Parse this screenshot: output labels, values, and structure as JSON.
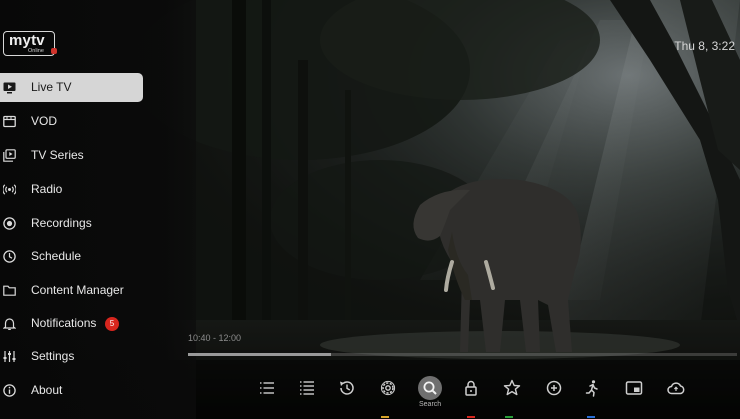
{
  "app": {
    "logo_text": "mytv",
    "logo_sub": "Online"
  },
  "clock": "Thu 8, 3:22",
  "sidebar": {
    "items": [
      {
        "label": "Live TV",
        "icon": "live-tv-icon",
        "active": true
      },
      {
        "label": "VOD",
        "icon": "vod-icon"
      },
      {
        "label": "TV Series",
        "icon": "tv-series-icon"
      },
      {
        "label": "Radio",
        "icon": "radio-icon"
      },
      {
        "label": "Recordings",
        "icon": "recordings-icon"
      },
      {
        "label": "Schedule",
        "icon": "schedule-icon"
      },
      {
        "label": "Content Manager",
        "icon": "folder-icon"
      },
      {
        "label": "Notifications",
        "icon": "bell-icon",
        "badge": "5"
      },
      {
        "label": "Settings",
        "icon": "sliders-icon"
      },
      {
        "label": "About",
        "icon": "info-icon"
      }
    ]
  },
  "player": {
    "time_range": "10:40 - 12:00",
    "progress_fraction": 0.26
  },
  "toolbar": {
    "buttons": [
      "list-icon",
      "list-numbered-icon",
      "history-icon",
      "gear-icon",
      "search-icon",
      "lock-icon",
      "star-icon",
      "add-icon",
      "running-person-icon",
      "picture-in-picture-icon",
      "cloud-icon"
    ],
    "search_label": "Search"
  },
  "colors": {
    "accent_red": "#d7261e",
    "active_bg": "#d6d6d6",
    "sidebar_bg": "#0a0a0a"
  }
}
